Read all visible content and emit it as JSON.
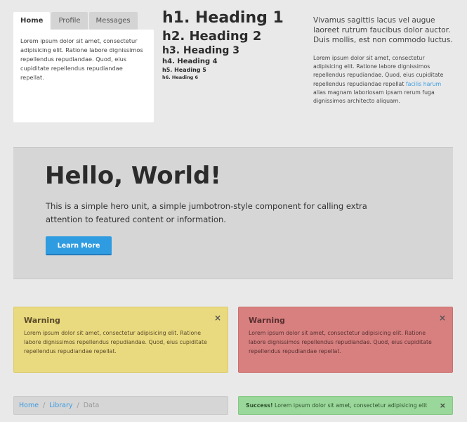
{
  "tabs": {
    "items": [
      "Home",
      "Profile",
      "Messages"
    ],
    "content": "Lorem ipsum dolor sit amet, consectetur adipisicing elit. Ratione labore dignissimos repellendus repudiandae. Quod, eius cupiditate repellendus repudiandae repellat."
  },
  "headings": {
    "h1": "h1. Heading 1",
    "h2": "h2. Heading 2",
    "h3": "h3. Heading 3",
    "h4": "h4. Heading 4",
    "h5": "h5. Heading 5",
    "h6": "h6. Heading 6"
  },
  "right_text": {
    "lead": "Vivamus sagittis lacus vel augue laoreet rutrum faucibus dolor auctor. Duis mollis, est non commodo luctus.",
    "small_before": "Lorem ipsum dolor sit amet, consectetur adipisicing elit. Ratione labore dignissimos repellendus repudiandae. Quod, eius cupiditate repellendus repudiandae repellat ",
    "link": "facilis harum",
    "small_after": " alias magnam laboriosam ipsam rerum fuga dignissimos architecto aliquam."
  },
  "hero": {
    "title": "Hello, World!",
    "text": "This is a simple hero unit, a simple jumbotron-style component for calling extra attention to featured content or information.",
    "button": "Learn More"
  },
  "alerts": [
    {
      "title": "Warning",
      "text": "Lorem ipsum dolor sit amet, consectetur adipisicing elit. Ratione labore dignissimos repellendus repudiandae. Quod, eius cupiditate repellendus repudiandae repellat.",
      "close": "×"
    },
    {
      "title": "Warning",
      "text": "Lorem ipsum dolor sit amet, consectetur adipisicing elit. Ratione labore dignissimos repellendus repudiandae. Quod, eius cupiditate repellendus repudiandae repellat.",
      "close": "×"
    }
  ],
  "breadcrumb": {
    "items": [
      "Home",
      "Library"
    ],
    "current": "Data",
    "separator": "/"
  },
  "success": {
    "label": "Success!",
    "text": "Lorem ipsum dolor sit amet, consectetur adipisicing elit",
    "close": "×"
  },
  "colors": {
    "accent": "#2f9be0",
    "warning_yellow": "#e9da7f",
    "warning_red": "#d88080",
    "success_green": "#9ad79a"
  }
}
